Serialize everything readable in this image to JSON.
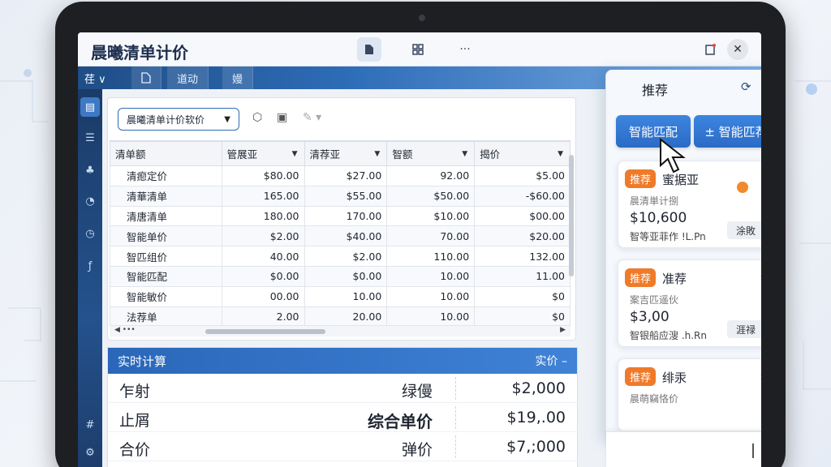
{
  "app": {
    "title": "晨曦清单计价"
  },
  "titlebar": {
    "icons": [
      "file-icon",
      "grid-icon",
      "more-icon",
      "note-icon",
      "close-icon"
    ],
    "close_symbol": "✕",
    "more_symbol": "···"
  },
  "ribbon": {
    "dropdown_label": "荏 ∨",
    "tabs": [
      "",
      "道动",
      "嫚"
    ]
  },
  "toolbar": {
    "selector_value": "晨曦清单计价软价"
  },
  "table": {
    "headers": [
      "清单额",
      "管展亚",
      "清荐亚",
      "智额",
      "揭价"
    ],
    "rows": [
      [
        "清瘛定价",
        "$80.00",
        "$27.00",
        "92.00",
        "$5.00"
      ],
      [
        "清華清单",
        "165.00",
        "$55.00",
        "$50.00",
        "-$60.00"
      ],
      [
        "清唐清单",
        "180.00",
        "170.00",
        "$10.00",
        "$00.00"
      ],
      [
        "智能单价",
        "$2.00",
        "$40.00",
        "70.00",
        "$20.00"
      ],
      [
        "智匹组价",
        "40.00",
        "$2.00",
        "110.00",
        "132.00"
      ],
      [
        "智能匹配",
        "$0.00",
        "$0.00",
        "10.00",
        "11.00"
      ],
      [
        "智能敏价",
        "00.00",
        "10.00",
        "10.00",
        "$0"
      ],
      [
        "法荐单",
        "2.00",
        "20.00",
        "10.00",
        "$0"
      ]
    ]
  },
  "calc": {
    "title": "实时计算",
    "right_label": "实价 –",
    "rows": [
      {
        "c1": "乍射",
        "c2": "绿僈",
        "c3": "$2,000"
      },
      {
        "c1": "止屑",
        "c2": "综合单价",
        "c3": "$19,.00"
      },
      {
        "c1": "合价",
        "c2": "弹价",
        "c3": "$7,;000"
      }
    ]
  },
  "rpanel": {
    "title": "推荐",
    "btn_match": "智能匹配",
    "btn_recommend": "± 智能匹荐",
    "cards": [
      {
        "badge": "推荐",
        "title": "蜜据亚",
        "sub": "晨清単计捌",
        "price": "$10,600",
        "meta": "智等亚菲作 !L.Pn",
        "btn": "涂敗"
      },
      {
        "badge": "推荐",
        "title": "准荐",
        "sub": "案吉匹遥伙",
        "price": "$3,00",
        "meta": "智银船应溲 .h.Rn",
        "btn": "涯禄"
      },
      {
        "badge": "推荐",
        "title": "绯汞",
        "sub": "晨萌竊恪价",
        "price": "",
        "meta": "",
        "btn": ""
      }
    ]
  },
  "colors": {
    "accent": "#2e6db8",
    "badge": "#ef7a2a",
    "rail": "#1b3b67"
  }
}
